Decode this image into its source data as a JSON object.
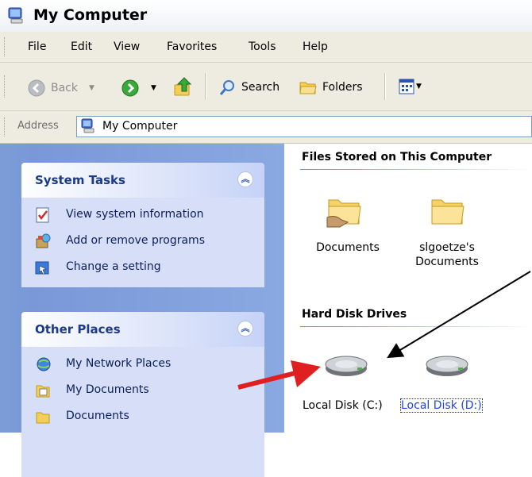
{
  "window": {
    "title": "My Computer"
  },
  "menu": [
    "File",
    "Edit",
    "View",
    "Favorites",
    "Tools",
    "Help"
  ],
  "toolbar": {
    "back": "Back",
    "search": "Search",
    "folders": "Folders"
  },
  "address": {
    "label": "Address",
    "value": "My Computer"
  },
  "system_tasks": {
    "title": "System Tasks",
    "items": [
      "View system information",
      "Add or remove programs",
      "Change a setting"
    ]
  },
  "other_places": {
    "title": "Other Places",
    "items": [
      "My Network Places",
      "My Documents",
      "Documents"
    ]
  },
  "files_section": {
    "title": "Files Stored on This Computer",
    "folders": [
      "Documents",
      "slgoetze's Documents"
    ]
  },
  "drives_section": {
    "title": "Hard Disk Drives",
    "drives": [
      "Local Disk (C:)",
      "Local Disk (D:)"
    ]
  },
  "colors": {
    "annotation_arrow": "#e02020",
    "accent_blue": "#1f48d9"
  }
}
